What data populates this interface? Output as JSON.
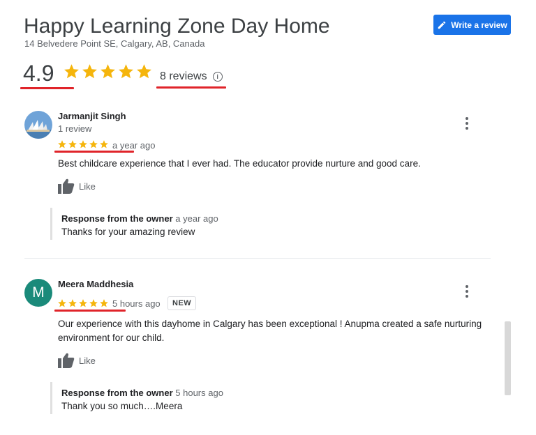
{
  "business": {
    "name": "Happy Learning Zone Day Home",
    "address": "14 Belvedere Point SE, Calgary, AB, Canada",
    "rating": "4.9",
    "stars": 5,
    "reviews_link": "8 reviews",
    "info_icon_glyph": "i"
  },
  "write_review_button": {
    "label": "Write a review",
    "icon": "pencil-icon"
  },
  "colors": {
    "star": "#f5b50c",
    "accent": "#1a73e8",
    "annotation": "#e0242a"
  },
  "reviews": [
    {
      "name": "Jarmanjit Singh",
      "review_count": "1 review",
      "stars": 5,
      "time": "a year ago",
      "text": "Best childcare experience that I ever had. The educator provide nurture and good care.",
      "like_label": "Like",
      "response": {
        "heading": "Response from the owner",
        "time": "a year ago",
        "text": "Thanks for your amazing review"
      }
    },
    {
      "name": "Meera Maddhesia",
      "avatar_letter": "M",
      "stars": 5,
      "time": "5 hours ago",
      "badge": "NEW",
      "text": "Our experience with this dayhome in Calgary has been exceptional ! Anupma created a safe nurturing environment for our child.",
      "like_label": "Like",
      "response": {
        "heading": "Response from the owner",
        "time": "5 hours ago",
        "text": "Thank you so much….Meera"
      }
    }
  ]
}
